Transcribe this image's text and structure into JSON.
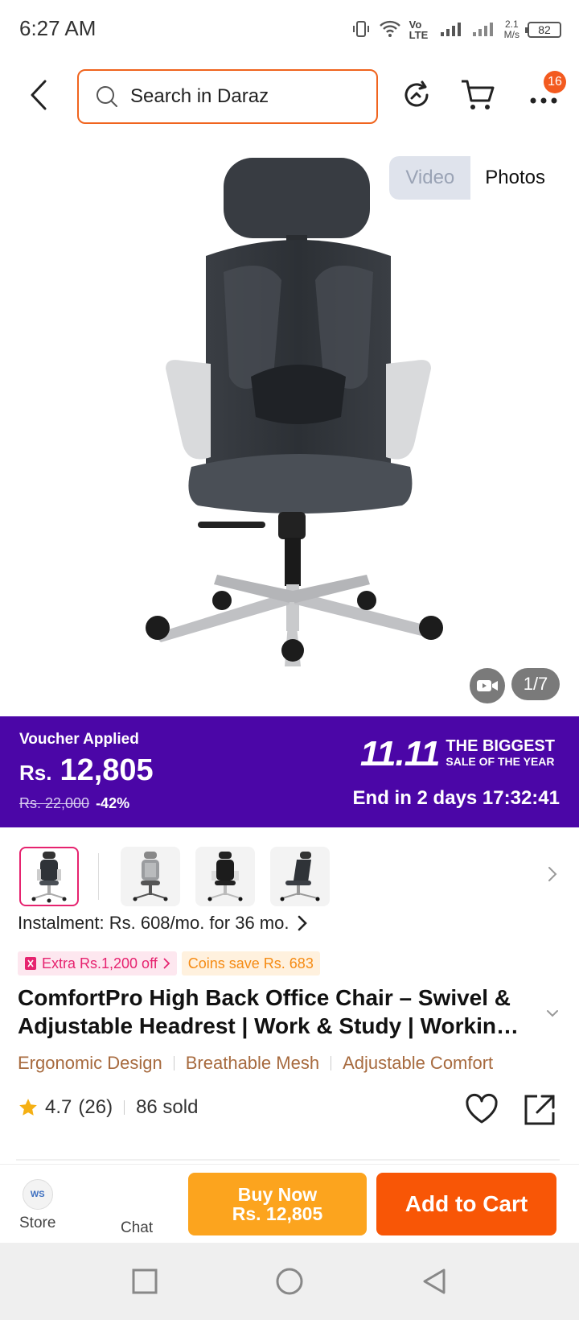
{
  "status_bar": {
    "time": "6:27 AM",
    "network_label": "Vo LTE",
    "speed_value": "2.1",
    "speed_unit": "M/s",
    "battery": "82"
  },
  "header": {
    "search_placeholder": "Search in Daraz",
    "cart_badge": "16"
  },
  "gallery": {
    "toggle_video": "Video",
    "toggle_photos": "Photos",
    "counter": "1/7"
  },
  "promo": {
    "voucher_label": "Voucher Applied",
    "currency": "Rs.",
    "price": "12,805",
    "old_price": "Rs. 22,000",
    "discount": "-42%",
    "sale_number": "11.11",
    "sale_line1": "The Biggest",
    "sale_line2": "Sale of the Year",
    "countdown": "End in 2 days 17:32:41",
    "background_color": "#4b06a7"
  },
  "product": {
    "instalment": "Instalment: Rs. 608/mo. for 36 mo.",
    "extra_off": "Extra Rs.1,200 off",
    "coins_save": "Coins save Rs. 683",
    "title": "ComfortPro High Back Office Chair – Swivel & Adjustable Headrest | Work & Study | Workin…",
    "features": [
      "Ergonomic Design",
      "Breathable Mesh",
      "Adjustable Comfort"
    ],
    "rating": "4.7",
    "reviews": "(26)",
    "sold": "86 sold"
  },
  "actions": {
    "store_label": "Store",
    "store_logo_text": "WS",
    "chat_label": "Chat",
    "buy_now_line1": "Buy Now",
    "buy_now_line2": "Rs. 12,805",
    "add_to_cart": "Add to Cart",
    "buy_color": "#fca41e",
    "cart_color": "#f85606",
    "accent_color": "#f0641e"
  }
}
